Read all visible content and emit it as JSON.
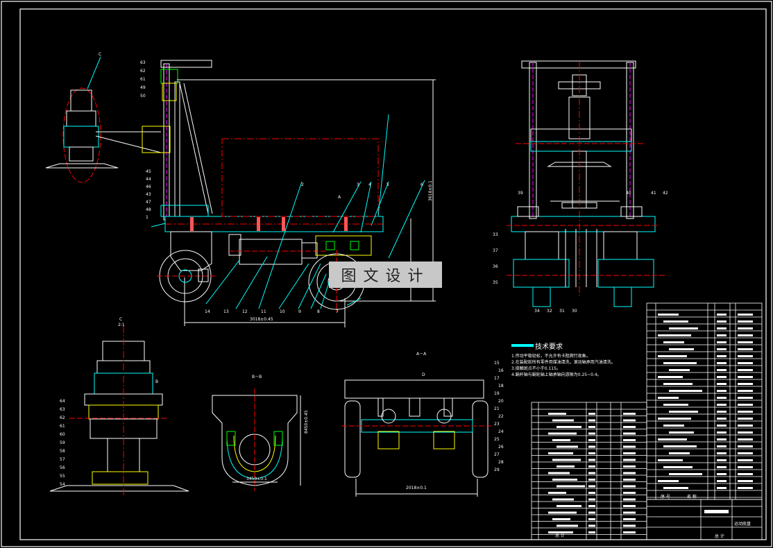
{
  "watermark": "图文设计",
  "tech_requirements": {
    "title": "技术要求",
    "items": [
      "1.传动平稳轻松，不允许有卡阻爬行现象。",
      "2.在装配前所有零件用煤油清洗，滚动轴承用汽油清洗。",
      "3.接触斑点不小于0.115。",
      "4.蜗杆轴与蜗轮轴上轴承轴向游隙为0.25~0.4。"
    ]
  },
  "view_labels": {
    "section_aa": "A－A",
    "section_bb": "B－B",
    "detail_c": "C",
    "detail_c_scale": "2:1",
    "marker_c": "C",
    "marker_a": "A",
    "marker_b": "B",
    "marker_d": "D"
  },
  "dimensions": {
    "main_width": "3018±0.45",
    "main_height": "3618±0.1",
    "aa_width": "2018±0.1",
    "bb_height": "8450±0.45",
    "bb_width": "3450±0.1"
  },
  "part_numbers": {
    "left_upper": [
      "63",
      "62",
      "61",
      "49",
      "50"
    ],
    "left_lower": [
      "45",
      "44",
      "46",
      "43",
      "47",
      "48",
      "1"
    ],
    "top_main": [
      "2",
      "3",
      "4",
      "5",
      "6"
    ],
    "bottom_main": [
      "14",
      "13",
      "12",
      "11",
      "10",
      "9",
      "8",
      "7"
    ],
    "right_view": [
      "39",
      "40",
      "41",
      "42",
      "33",
      "37",
      "36",
      "35",
      "34",
      "32",
      "31",
      "30"
    ],
    "detail_c": [
      "64",
      "63",
      "62",
      "61",
      "60",
      "59",
      "58",
      "57",
      "56",
      "55",
      "54"
    ],
    "section_aa": [
      "15",
      "16",
      "17",
      "18",
      "19",
      "20",
      "21",
      "22",
      "23",
      "24",
      "25",
      "26",
      "27",
      "28",
      "29"
    ]
  },
  "title_block": {
    "design_name": "运动底盘",
    "sign_label": "总 计",
    "left_footer": "总 计",
    "columns": [
      "序 号",
      "名 称"
    ]
  }
}
